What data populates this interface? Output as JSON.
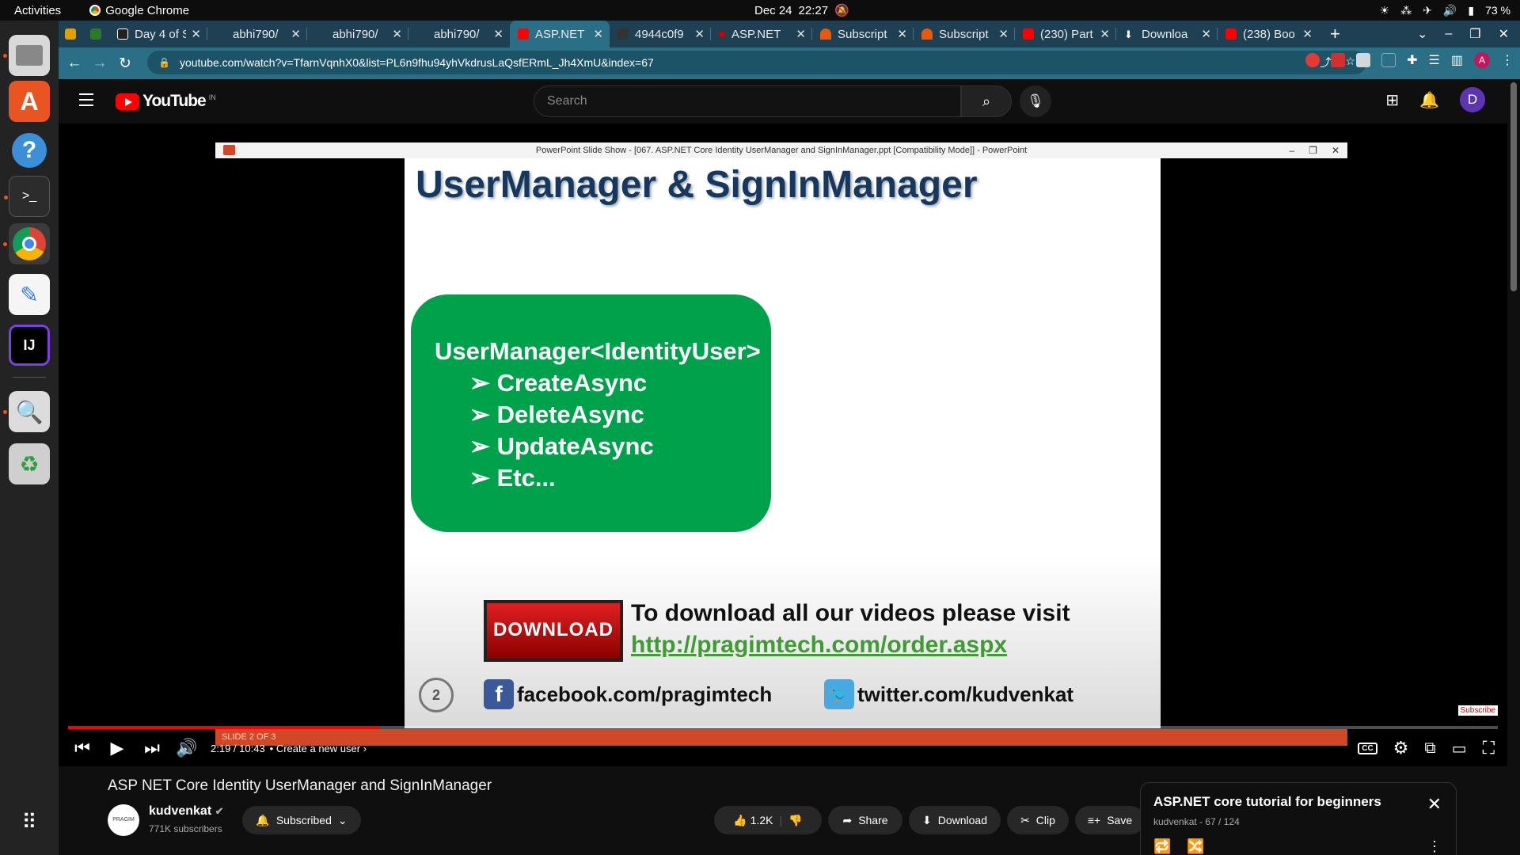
{
  "os": {
    "activities": "Activities",
    "app_name": "Google Chrome",
    "date": "Dec 24",
    "time": "22:27",
    "battery": "73 %"
  },
  "dock": {
    "items": [
      "files-icon",
      "software-center-icon",
      "help-icon",
      "terminal-icon",
      "chrome-icon",
      "text-editor-icon",
      "intellij-icon",
      "search-tool-icon",
      "trash-icon",
      "app-grid-icon"
    ]
  },
  "browser": {
    "tabs": [
      {
        "label": "",
        "fav": "#e0a000"
      },
      {
        "label": "",
        "fav": "#2a7a2a"
      },
      {
        "label": "Day 4 of S",
        "fav": "#222"
      },
      {
        "label": "abhi790/",
        "fav": "#1f3f52"
      },
      {
        "label": "abhi790/",
        "fav": "#1f3f52"
      },
      {
        "label": "abhi790/",
        "fav": "#1f3f52"
      },
      {
        "label": "ASP.NET",
        "fav": "#ff0000",
        "active": true
      },
      {
        "label": "4944c0f9",
        "fav": "#333"
      },
      {
        "label": "ASP.NET",
        "fav": "#cc0000"
      },
      {
        "label": "Subscript",
        "fav": "#e8590c"
      },
      {
        "label": "Subscript",
        "fav": "#e8590c"
      },
      {
        "label": "(230) Part",
        "fav": "#ff0000"
      },
      {
        "label": "Downloa",
        "fav": "#ffffff"
      },
      {
        "label": "(238) Boo",
        "fav": "#ff0000"
      }
    ],
    "url": "youtube.com/watch?v=TfarnVqnhX0&list=PL6n9fhu94yhVkdrusLaQsfERmL_Jh4XmU&index=67"
  },
  "youtube": {
    "logo_text": "YouTube",
    "region": "IN",
    "search_placeholder": "Search",
    "avatar_letter": "D",
    "player": {
      "ppt_window_title": "PowerPoint Slide Show - [067. ASP.NET Core Identity UserManager and SignInManager.ppt [Compatibility Mode]] - PowerPoint",
      "slide": {
        "title": "UserManager & SignInManager",
        "box_heading": "UserManager<IdentityUser>",
        "box_items": [
          "CreateAsync",
          "DeleteAsync",
          "UpdateAsync",
          "Etc..."
        ],
        "download_button": "DOWNLOAD",
        "download_text": "To download all our videos please visit",
        "download_link": "http://pragimtech.com/order.aspx",
        "slide_number": "2",
        "facebook": "facebook.com/pragimtech",
        "twitter": "twitter.com/kudvenkat",
        "subscribe_watermark": "Subscribe"
      },
      "ppt_status": "SLIDE 2 OF 3",
      "progress": 0.218,
      "time": "2:19 / 10:43",
      "chapter": "Create a new user"
    },
    "video": {
      "title": "ASP NET Core Identity UserManager and SignInManager",
      "channel": "kudvenkat",
      "channel_avatar": "PRAGIM",
      "subscribers": "771K subscribers",
      "subscribe_label": "Subscribed",
      "likes": "1.2K",
      "share": "Share",
      "download": "Download",
      "clip": "Clip",
      "save": "Save"
    },
    "playlist": {
      "title": "ASP.NET core tutorial for beginners",
      "meta": "kudvenkat - 67 / 124"
    }
  }
}
